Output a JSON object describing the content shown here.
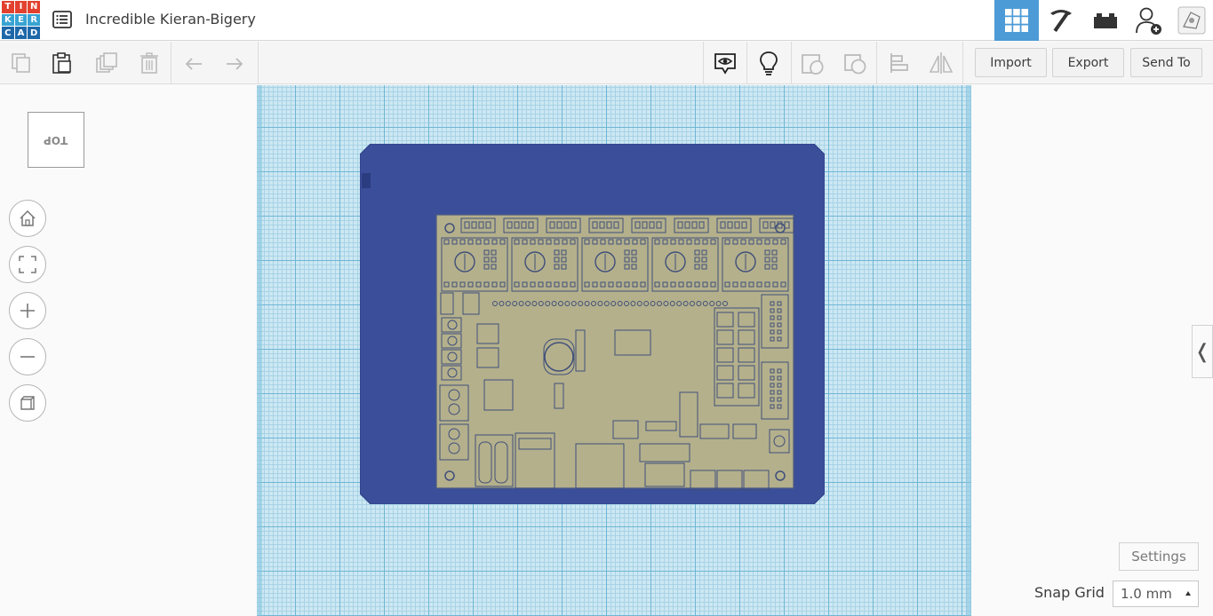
{
  "logo": {
    "letters": [
      "T",
      "I",
      "N",
      "K",
      "E",
      "R",
      "C",
      "A",
      "D"
    ],
    "colors": [
      "#e2412e",
      "#e2412e",
      "#e2412e",
      "#39a3d3",
      "#39a3d3",
      "#39a3d3",
      "#1e68a9",
      "#1e68a9",
      "#1e68a9"
    ]
  },
  "header": {
    "title": "Incredible Kieran-Bigery"
  },
  "view_switch": {
    "icons": [
      "3d-design-grid-icon",
      "circuits-pickaxe-icon",
      "codeblocks-brick-icon",
      "add-user-icon",
      "profile-avatar-icon"
    ],
    "active": "3d-design-grid-icon"
  },
  "toolbar": {
    "icons_left": [
      "copy-icon",
      "paste-icon",
      "duplicate-icon",
      "delete-icon",
      "undo-icon",
      "redo-icon"
    ],
    "icons_right": [
      "notes-eye-icon",
      "lightbulb-icon",
      "group-icon",
      "ungroup-icon",
      "align-icon",
      "mirror-icon"
    ],
    "import_label": "Import",
    "export_label": "Export",
    "send_to_label": "Send To"
  },
  "viewcube": {
    "face_label": "TOP"
  },
  "nav": [
    "home-icon",
    "fit-view-icon",
    "zoom-in-icon",
    "zoom-out-icon",
    "ortho-view-icon"
  ],
  "side_panel": {
    "toggle_glyph": "❬"
  },
  "footer": {
    "settings_label": "Settings",
    "snap_grid_label": "Snap Grid",
    "snap_grid_value": "1.0 mm"
  },
  "colors": {
    "accent": "#4d9bd6",
    "plate": "#3b4e99",
    "board": "#b4b08c",
    "grid": "#cde8f3"
  }
}
